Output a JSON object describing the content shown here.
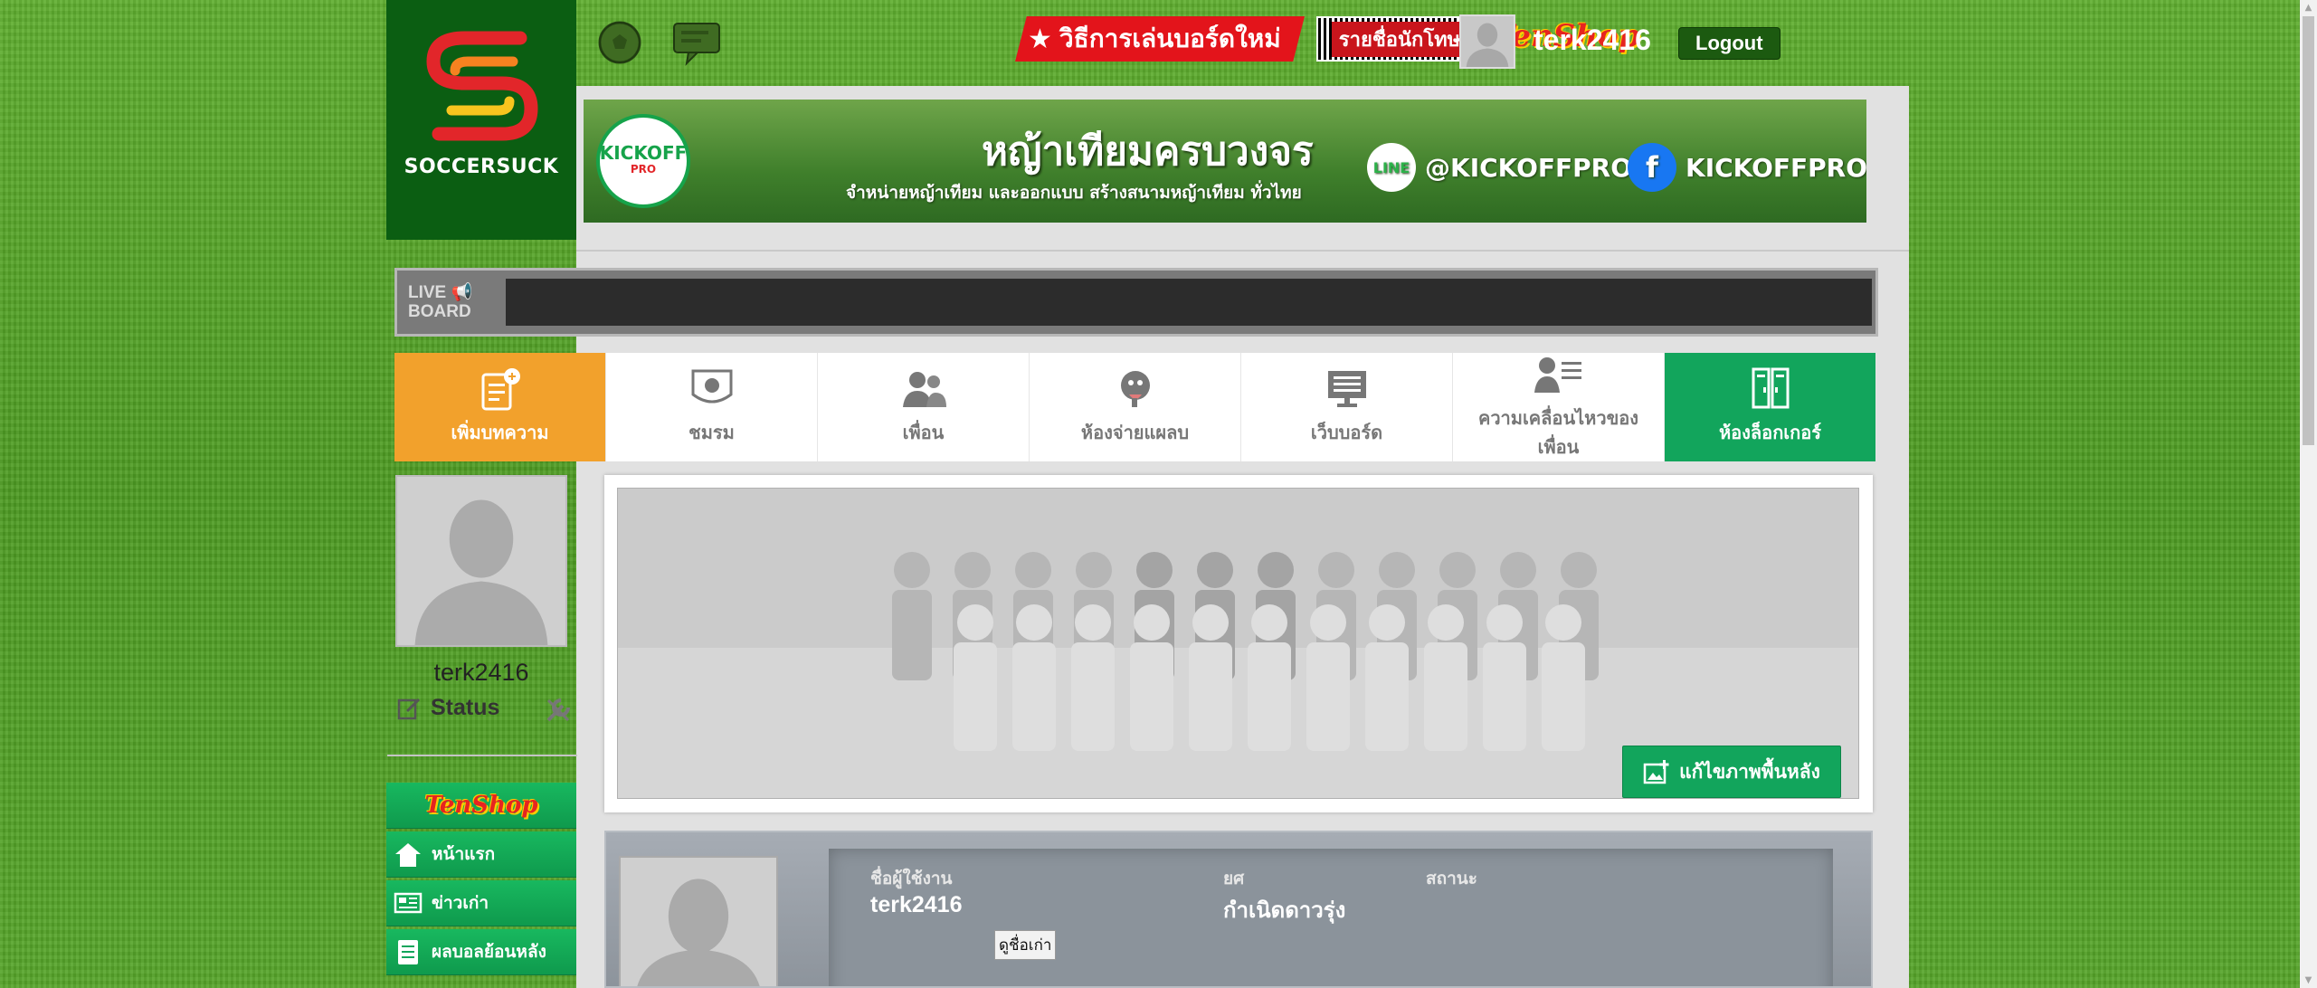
{
  "logo": {
    "brand": "SOCCERSUCK"
  },
  "topbar": {
    "promo_rules": "วิธีการเล่นบอร์ดใหม่",
    "promo_ban": "รายชื่อนักโทษ",
    "tenshop": "TenShop",
    "username": "terk2416",
    "logout": "Logout"
  },
  "ad": {
    "logo_text": "KICKOFF",
    "logo_sub": "PRO",
    "headline": "หญ้าเทียมครบวงจร",
    "sub": "จำหน่ายหญ้าเทียม และออกแบบ สร้างสนามหญ้าเทียม ทั่วไทย",
    "line_badge": "LINE",
    "line_handle": "@KICKOFFPRO",
    "fb_badge": "f",
    "fb_handle": "KICKOFFPRO"
  },
  "liveboard": {
    "line1": "LIVE",
    "line2": "BOARD"
  },
  "nav": [
    {
      "label": "เพิ่มบทความ",
      "icon": "add-article-icon"
    },
    {
      "label": "ชมรม",
      "icon": "club-icon"
    },
    {
      "label": "เพื่อน",
      "icon": "friends-icon"
    },
    {
      "label": "ห้องจ่ายแผลบ",
      "icon": "chat-room-icon"
    },
    {
      "label": "เว็บบอร์ด",
      "icon": "webboard-icon"
    },
    {
      "label": "ความเคลื่อนไหวของเพื่อน",
      "icon": "friends-activity-icon"
    },
    {
      "label": "ห้องล็อกเกอร์",
      "icon": "locker-room-icon"
    }
  ],
  "profile": {
    "name": "terk2416",
    "status": "Status"
  },
  "sidemenu": [
    {
      "label": "หน้าแรก",
      "icon": "home-icon"
    },
    {
      "label": "ข่าวเก่า",
      "icon": "old-news-icon"
    },
    {
      "label": "ผลบอลย้อนหลัง",
      "icon": "past-results-icon"
    }
  ],
  "cover": {
    "edit_label": "แก้ไขภาพพื้นหลัง"
  },
  "info": {
    "username_label": "ชื่อผู้ใช้งาน",
    "username_value": "terk2416",
    "old_names": "ดูชื่อเก่า",
    "rank_label": "ยศ",
    "rank_value": "กำเนิดดาวรุ่ง",
    "status_label": "สถานะ"
  },
  "colors": {
    "orange": "#f2a12c",
    "green": "#12a55c",
    "logo_bg": "#0b5e12",
    "promo_red": "#e3141b"
  }
}
